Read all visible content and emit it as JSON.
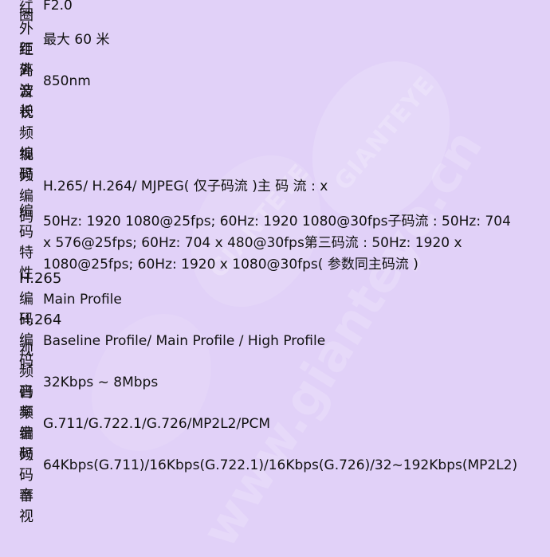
{
  "rows": [
    {
      "label": "光圈",
      "value": "F2.0"
    },
    {
      "label": "红外\n距离",
      "value": "最大 60 米"
    },
    {
      "label": "红外\n波长",
      "value": "850nm"
    },
    {
      "label": "音视\n频编\n码",
      "value": ""
    },
    {
      "label": "视频\n编码",
      "value": "H.265/ H.264/ MJPEG( 仅子码流 )主 码 流 : x"
    },
    {
      "label": "编码\n特性",
      "value": "50Hz: 1920 1080@25fps; 60Hz: 1920 1080@30fps子码流 : 50Hz: 704\nx 576@25fps; 60Hz: 704 x 480@30fps第三码流 : 50Hz: 1920 x\n1080@25fps; 60Hz: 1920 x 1080@30fps( 参数同主码流 )"
    },
    {
      "label": "H.265\n编码",
      "value": "Main Profile"
    },
    {
      "label": "H.264\n编码",
      "value": "Baseline Profile/ Main Profile / High Profile"
    },
    {
      "label": "视频\n码率",
      "value": "32Kbps ~ 8Mbps"
    },
    {
      "label": "音频\n编码",
      "value": "G.711/G.722.1/G.726/MP2L2/PCM"
    },
    {
      "label": "音频\n码率",
      "value": "64Kbps(G.711)/16Kbps(G.722.1)/16Kbps(G.726)/32~192Kbps(MP2L2)"
    },
    {
      "label": "音视",
      "value": ""
    }
  ],
  "watermark": {
    "brand": "GIANTEYE",
    "url": "www.gianteye.cn"
  }
}
